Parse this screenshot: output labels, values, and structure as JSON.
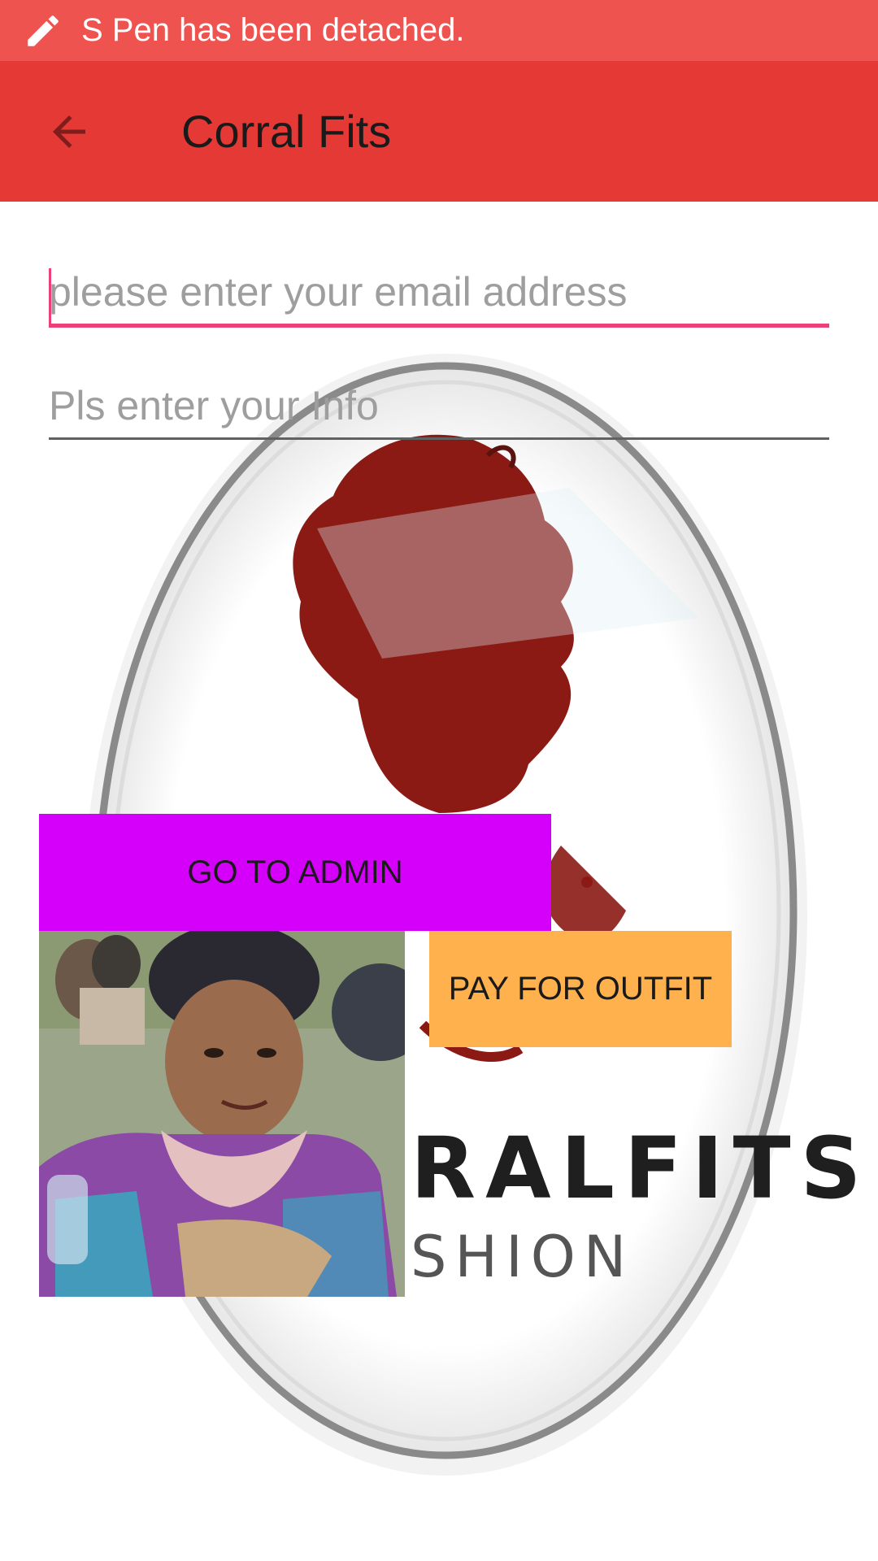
{
  "status_bar": {
    "message": "S Pen has been detached.",
    "icon": "pen-icon"
  },
  "app_bar": {
    "title": "Corral Fits",
    "back_icon": "arrow-back-icon"
  },
  "form": {
    "email_placeholder": "please enter your email address",
    "email_value": "",
    "info_placeholder": "Pls enter your Info",
    "info_value": ""
  },
  "buttons": {
    "admin_label": "GO TO ADMIN",
    "pay_label": "PAY FOR OUTFIT"
  },
  "logo": {
    "text_line1": "RALFITS",
    "text_line2": "SHION"
  },
  "colors": {
    "status_bar": "#ef5350",
    "app_bar": "#e53935",
    "accent": "#ec407a",
    "admin_button": "#d500f9",
    "pay_button": "#ffb14e",
    "logo_red": "#8b1a14"
  }
}
